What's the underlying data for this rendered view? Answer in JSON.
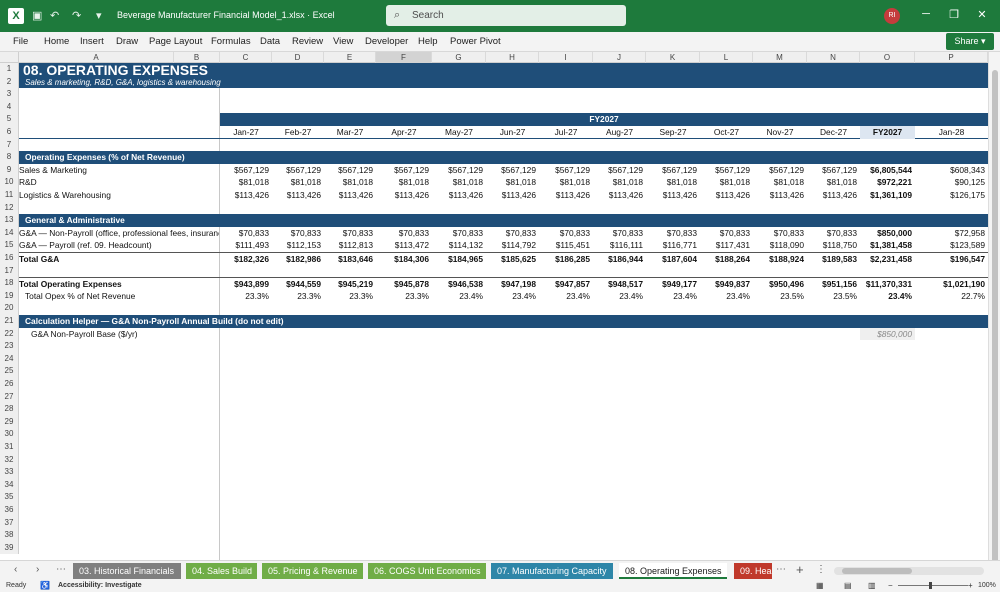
{
  "window": {
    "filename": "Beverage Manufacturer Financial Model_1.xlsx  ·  Excel",
    "search_placeholder": "Search",
    "avatar_initials": "RI"
  },
  "ribbon_tabs": [
    "File",
    "Home",
    "Insert",
    "Draw",
    "Page Layout",
    "Formulas",
    "Data",
    "Review",
    "View",
    "Developer",
    "Help",
    "Power Pivot"
  ],
  "share_label": "Share",
  "columns": [
    "A",
    "B",
    "C",
    "D",
    "E",
    "F",
    "G",
    "H",
    "I",
    "J",
    "K",
    "L",
    "M",
    "N",
    "O",
    "P"
  ],
  "selected_column": "F",
  "rows": [
    "1",
    "2",
    "3",
    "4",
    "5",
    "6",
    "7",
    "8",
    "9",
    "10",
    "11",
    "12",
    "13",
    "14",
    "15",
    "16",
    "17",
    "18",
    "19",
    "20",
    "21",
    "22",
    "23",
    "24",
    "25",
    "26",
    "27",
    "28",
    "29",
    "30",
    "31",
    "32",
    "33",
    "34",
    "35",
    "36",
    "37",
    "38",
    "39"
  ],
  "sheet": {
    "title": "08.  OPERATING EXPENSES",
    "subtitle": "Sales & marketing, R&D, G&A, logistics & warehousing",
    "fy_label": "FY2027",
    "months": [
      "Jan-27",
      "Feb-27",
      "Mar-27",
      "Apr-27",
      "May-27",
      "Jun-27",
      "Jul-27",
      "Aug-27",
      "Sep-27",
      "Oct-27",
      "Nov-27",
      "Dec-27",
      "FY2027",
      "Jan-28"
    ],
    "section_opex": "Operating Expenses (% of Net Revenue)",
    "sales_marketing": {
      "label": "Sales & Marketing",
      "values": [
        "$567,129",
        "$567,129",
        "$567,129",
        "$567,129",
        "$567,129",
        "$567,129",
        "$567,129",
        "$567,129",
        "$567,129",
        "$567,129",
        "$567,129",
        "$567,129",
        "$6,805,544",
        "$608,343"
      ]
    },
    "rnd": {
      "label": "R&D",
      "values": [
        "$81,018",
        "$81,018",
        "$81,018",
        "$81,018",
        "$81,018",
        "$81,018",
        "$81,018",
        "$81,018",
        "$81,018",
        "$81,018",
        "$81,018",
        "$81,018",
        "$972,221",
        "$90,125"
      ]
    },
    "logistics": {
      "label": "Logistics & Warehousing",
      "values": [
        "$113,426",
        "$113,426",
        "$113,426",
        "$113,426",
        "$113,426",
        "$113,426",
        "$113,426",
        "$113,426",
        "$113,426",
        "$113,426",
        "$113,426",
        "$113,426",
        "$1,361,109",
        "$126,175"
      ]
    },
    "section_ga": "General & Administrative",
    "ga_nonpayroll": {
      "label": "G&A — Non-Payroll (office, professional fees, insurance)",
      "values": [
        "$70,833",
        "$70,833",
        "$70,833",
        "$70,833",
        "$70,833",
        "$70,833",
        "$70,833",
        "$70,833",
        "$70,833",
        "$70,833",
        "$70,833",
        "$70,833",
        "$850,000",
        "$72,958"
      ]
    },
    "ga_payroll": {
      "label": "G&A — Payroll (ref. 09. Headcount)",
      "values": [
        "$111,493",
        "$112,153",
        "$112,813",
        "$113,472",
        "$114,132",
        "$114,792",
        "$115,451",
        "$116,111",
        "$116,771",
        "$117,431",
        "$118,090",
        "$118,750",
        "$1,381,458",
        "$123,589"
      ]
    },
    "total_ga": {
      "label": "Total G&A",
      "values": [
        "$182,326",
        "$182,986",
        "$183,646",
        "$184,306",
        "$184,965",
        "$185,625",
        "$186,285",
        "$186,944",
        "$187,604",
        "$188,264",
        "$188,924",
        "$189,583",
        "$2,231,458",
        "$196,547"
      ]
    },
    "total_opex": {
      "label": "Total Operating Expenses",
      "values": [
        "$943,899",
        "$944,559",
        "$945,219",
        "$945,878",
        "$946,538",
        "$947,198",
        "$947,857",
        "$948,517",
        "$949,177",
        "$949,837",
        "$950,496",
        "$951,156",
        "$11,370,331",
        "$1,021,190"
      ]
    },
    "opex_pct": {
      "label": "Total Opex % of Net Revenue",
      "values": [
        "23.3%",
        "23.3%",
        "23.3%",
        "23.3%",
        "23.4%",
        "23.4%",
        "23.4%",
        "23.4%",
        "23.4%",
        "23.4%",
        "23.5%",
        "23.5%",
        "23.4%",
        "22.7%"
      ]
    },
    "section_calc": "Calculation Helper — G&A Non-Payroll Annual Build (do not edit)",
    "calc_label": "G&A Non-Payroll Base ($/yr)",
    "calc_value": "$850,000"
  },
  "sheet_tabs": [
    {
      "label": "03. Historical Financials",
      "color": "#7f7f7f"
    },
    {
      "label": "04. Sales Build",
      "color": "#70ad47"
    },
    {
      "label": "05. Pricing & Revenue",
      "color": "#70ad47"
    },
    {
      "label": "06. COGS Unit Economics",
      "color": "#70ad47"
    },
    {
      "label": "07. Manufacturing Capacity",
      "color": "#2e86a8"
    },
    {
      "label": "08. Operating Expenses",
      "color": "#ffffff"
    },
    {
      "label": "09. Hea",
      "color": "#c0392b"
    }
  ],
  "status": {
    "ready": "Ready",
    "accessibility": "Accessibility: Investigate",
    "zoom": "100%"
  }
}
